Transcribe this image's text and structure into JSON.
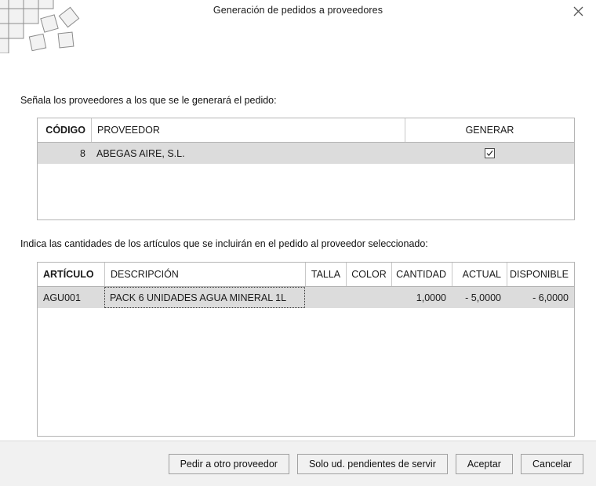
{
  "window": {
    "title": "Generación de pedidos a proveedores",
    "close_label": "✕",
    "close_icon": "close-icon",
    "logo_icon": "app-logo-squares"
  },
  "captions": {
    "providers": "Señala los proveedores a los que se le generará el pedido:",
    "articles": "Indica las cantidades de los artículos que se incluirán en el pedido al proveedor seleccionado:"
  },
  "providers_table": {
    "columns": [
      {
        "key": "codigo",
        "label": "CÓDIGO",
        "align": "right",
        "bold": true
      },
      {
        "key": "proveedor",
        "label": "PROVEEDOR",
        "align": "left",
        "bold": false
      },
      {
        "key": "generar",
        "label": "GENERAR",
        "align": "center",
        "bold": false
      }
    ],
    "rows": [
      {
        "codigo": "8",
        "proveedor": "ABEGAS AIRE, S.L.",
        "generar": true
      }
    ],
    "checkbox_icon": "checkmark-icon"
  },
  "articles_table": {
    "columns": [
      {
        "key": "articulo",
        "label": "ARTÍCULO",
        "align": "left",
        "bold": true
      },
      {
        "key": "descripcion",
        "label": "DESCRIPCIÓN",
        "align": "left",
        "bold": false
      },
      {
        "key": "talla",
        "label": "TALLA",
        "align": "center",
        "bold": false
      },
      {
        "key": "color",
        "label": "COLOR",
        "align": "center",
        "bold": false
      },
      {
        "key": "cantidad",
        "label": "CANTIDAD",
        "align": "right",
        "bold": false
      },
      {
        "key": "actual",
        "label": "ACTUAL",
        "align": "right",
        "bold": false
      },
      {
        "key": "disponible",
        "label": "DISPONIBLE",
        "align": "right",
        "bold": false
      }
    ],
    "rows": [
      {
        "articulo": "AGU001",
        "descripcion": "PACK 6 UNIDADES AGUA MINERAL 1L",
        "talla": "",
        "color": "",
        "cantidad": "1,0000",
        "actual": "- 5,0000",
        "disponible": "- 6,0000"
      }
    ]
  },
  "footer": {
    "buttons": [
      {
        "name": "pedir-otro-proveedor",
        "label": "Pedir a otro proveedor"
      },
      {
        "name": "solo-pendientes-servir",
        "label": "Solo ud. pendientes de servir"
      },
      {
        "name": "aceptar",
        "label": "Aceptar"
      },
      {
        "name": "cancelar",
        "label": "Cancelar"
      }
    ]
  },
  "colors": {
    "row_selected_bg": "#dcdcdc",
    "grid_border": "#b4b4b4",
    "footer_bg": "#f1f1f1",
    "text": "#1a1a1a"
  }
}
